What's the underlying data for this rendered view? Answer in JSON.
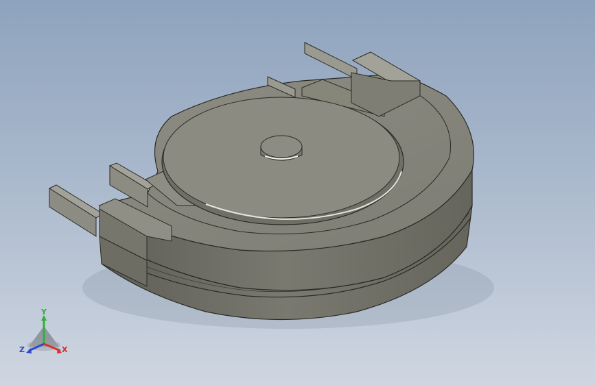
{
  "triad": {
    "x_label": "X",
    "y_label": "Y",
    "z_label": "Z",
    "x_color": "#d8312a",
    "y_color": "#2fb03a",
    "z_color": "#2e48c8"
  },
  "model": {
    "body_color": "#7d7c72",
    "top_color": "#8a8a80",
    "edge_color": "#2a2a26"
  }
}
